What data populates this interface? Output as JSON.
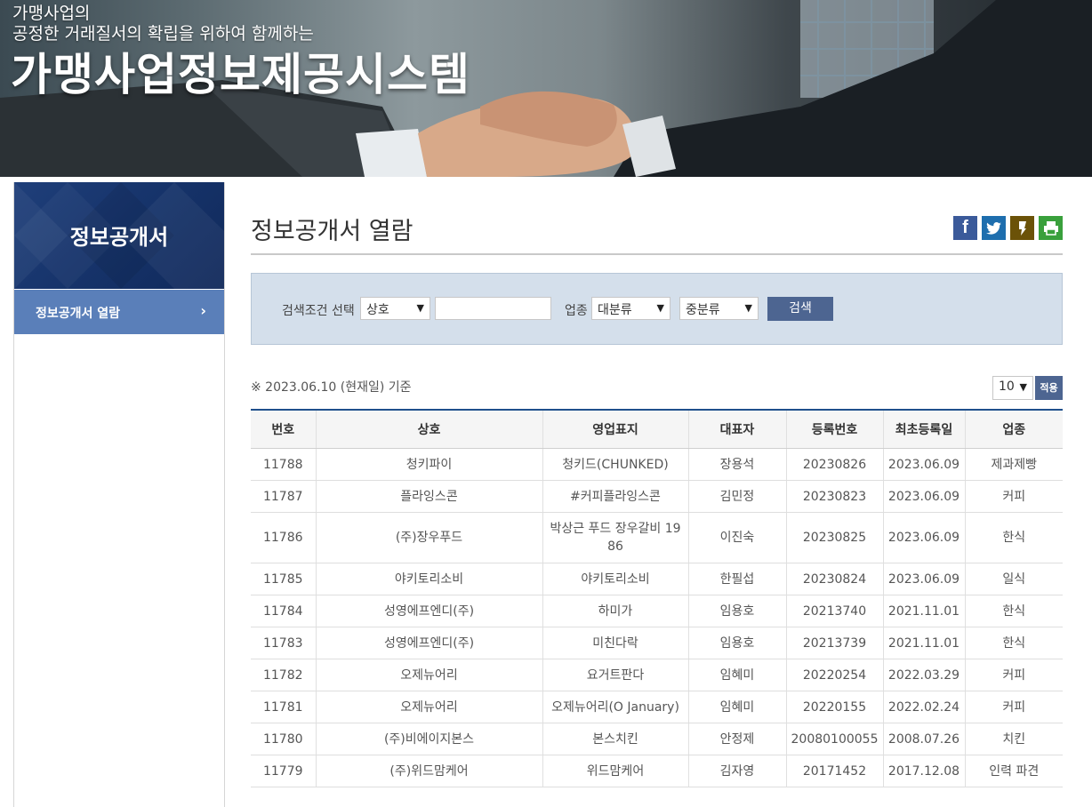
{
  "banner": {
    "tagline_line1": "가맹사업의",
    "tagline_line2": "공정한 거래질서의 확립을 위하여 함께하는",
    "site_title": "가맹사업정보제공시스템"
  },
  "sidebar": {
    "title": "정보공개서",
    "items": [
      {
        "label": "정보공개서 열람",
        "chevron": "›"
      }
    ]
  },
  "main": {
    "page_title": "정보공개서 열람",
    "share_buttons": [
      {
        "icon": "facebook-icon",
        "glyph": "f",
        "color": "#3b5a9a"
      },
      {
        "icon": "twitter-icon",
        "glyph": "t",
        "color": "#1e6eae"
      },
      {
        "icon": "kakaostory-icon",
        "glyph": "s",
        "color": "#6b5208"
      },
      {
        "icon": "print-icon",
        "glyph": "p",
        "color": "#39a03c"
      }
    ],
    "search": {
      "condition_label": "검색조건 선택",
      "condition_value": "상호",
      "keyword_value": "",
      "business_label": "업종",
      "major_value": "대분류",
      "minor_value": "중분류",
      "search_button": "검색"
    },
    "basis_text": "※ 2023.06.10 (현재일) 기준",
    "rows_per_page": "10",
    "apply_button": "적용",
    "table": {
      "headers": [
        "번호",
        "상호",
        "영업표지",
        "대표자",
        "등록번호",
        "최초등록일",
        "업종"
      ],
      "rows": [
        [
          "11788",
          "청키파이",
          "청키드(CHUNKED)",
          "장용석",
          "20230826",
          "2023.06.09",
          "제과제빵"
        ],
        [
          "11787",
          "플라잉스콘",
          "#커피플라잉스콘",
          "김민정",
          "20230823",
          "2023.06.09",
          "커피"
        ],
        [
          "11786",
          "(주)장우푸드",
          "박상근 푸드 장우갈비 1986",
          "이진숙",
          "20230825",
          "2023.06.09",
          "한식"
        ],
        [
          "11785",
          "야키토리소비",
          "야키토리소비",
          "한필섭",
          "20230824",
          "2023.06.09",
          "일식"
        ],
        [
          "11784",
          "성영에프엔디(주)",
          "하미가",
          "임용호",
          "20213740",
          "2021.11.01",
          "한식"
        ],
        [
          "11783",
          "성영에프엔디(주)",
          "미친다락",
          "임용호",
          "20213739",
          "2021.11.01",
          "한식"
        ],
        [
          "11782",
          "오제뉴어리",
          "요거트판다",
          "임혜미",
          "20220254",
          "2022.03.29",
          "커피"
        ],
        [
          "11781",
          "오제뉴어리",
          "오제뉴어리(O January)",
          "임혜미",
          "20220155",
          "2022.02.24",
          "커피"
        ],
        [
          "11780",
          "(주)비에이지본스",
          "본스치킨",
          "안정제",
          "20080100055",
          "2008.07.26",
          "치킨"
        ],
        [
          "11779",
          "(주)위드맘케어",
          "위드맘케어",
          "김자영",
          "20171452",
          "2017.12.08",
          "인력 파견"
        ]
      ]
    }
  }
}
